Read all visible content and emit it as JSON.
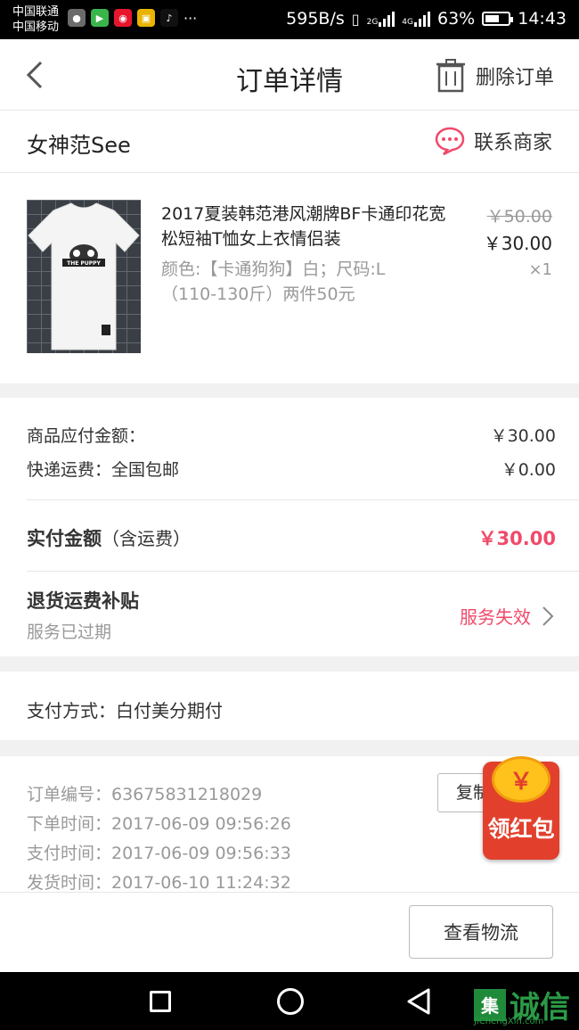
{
  "status_bar": {
    "carrier1": "中国联通",
    "carrier2": "中国移动",
    "speed": "595B/s",
    "net1": "2G",
    "net2": "4G",
    "battery": "63%",
    "battery_level": 0.63,
    "time": "14:43"
  },
  "header": {
    "title": "订单详情",
    "delete_label": "删除订单"
  },
  "shop": {
    "name": "女神范See",
    "contact_label": "联系商家"
  },
  "product": {
    "title": "2017夏装韩范港风潮牌BF卡通印花宽松短袖T恤女上衣情侣装",
    "spec": "颜色:【卡通狗狗】白；尺码:L（110-130斤）两件50元",
    "original_price": "￥50.00",
    "price": "￥30.00",
    "quantity": "×1",
    "print_text": "THE PUPPY"
  },
  "amounts": {
    "goods_label": "商品应付金额：",
    "goods_value": "￥30.00",
    "shipping_label": "快递运费：全国包邮",
    "shipping_value": "￥0.00",
    "paid_label": "实付金额",
    "paid_note": "（含运费）",
    "paid_value": "￥30.00",
    "refund_title": "退货运费补贴",
    "refund_sub": "服务已过期",
    "refund_status": "服务失效"
  },
  "payment": {
    "method": "支付方式：白付美分期付"
  },
  "order_info": {
    "order_no": "订单编号：63675831218029",
    "order_time": "下单时间：2017-06-09  09:56:26",
    "pay_time": "支付时间：2017-06-09  09:56:33",
    "ship_time": "发货时间：2017-06-10  11:24:32",
    "copy_label": "复制"
  },
  "red_packet": {
    "coin": "￥",
    "label": "领红包"
  },
  "bottom": {
    "logistics_label": "查看物流"
  },
  "watermark": {
    "box": "集",
    "text": "诚信",
    "sub": "JiChengXin.com"
  },
  "colors": {
    "accent": "#f04a6a",
    "red_packet": "#e2402d",
    "coin": "#ffc21c"
  }
}
